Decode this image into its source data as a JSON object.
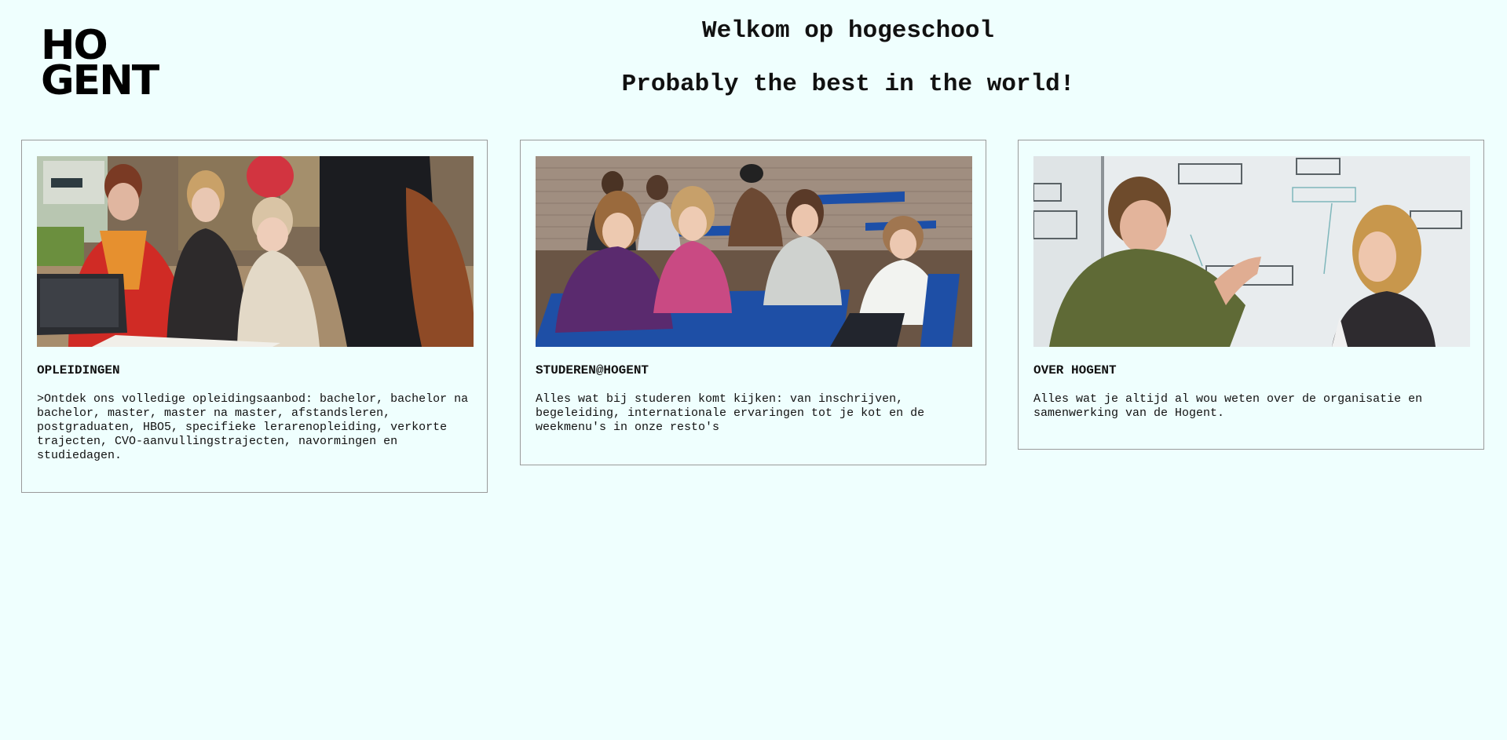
{
  "logo": {
    "line1": "HO",
    "line2": "GENT"
  },
  "header": {
    "title": "Welkom op hogeschool",
    "subtitle": "Probably the best in the world!"
  },
  "cards": [
    {
      "title": "OPLEIDINGEN",
      "text": ">Ontdek ons volledige opleidingsaanbod: bachelor, bachelor na bachelor, master, master na master, afstandsleren, postgraduaten, HBO5, specifieke lerarenopleiding, verkorte trajecten, CVO-aanvullingstrajecten, navormingen en studiedagen.",
      "image": "students-studying-photo"
    },
    {
      "title": "STUDEREN@HOGENT",
      "text": "Alles wat bij studeren komt kijken: van inschrijven, begeleiding, internationale ervaringen tot je kot en de weekmenu's in onze resto's",
      "image": "students-outdoor-tables-photo"
    },
    {
      "title": "OVER HOGENT",
      "text": "Alles wat je altijd al wou weten over de organisatie en samenwerking van de Hogent.",
      "image": "students-whiteboard-photo"
    }
  ],
  "colors": {
    "background": "#effffe",
    "border": "#9a9a9a",
    "text": "#111111"
  }
}
